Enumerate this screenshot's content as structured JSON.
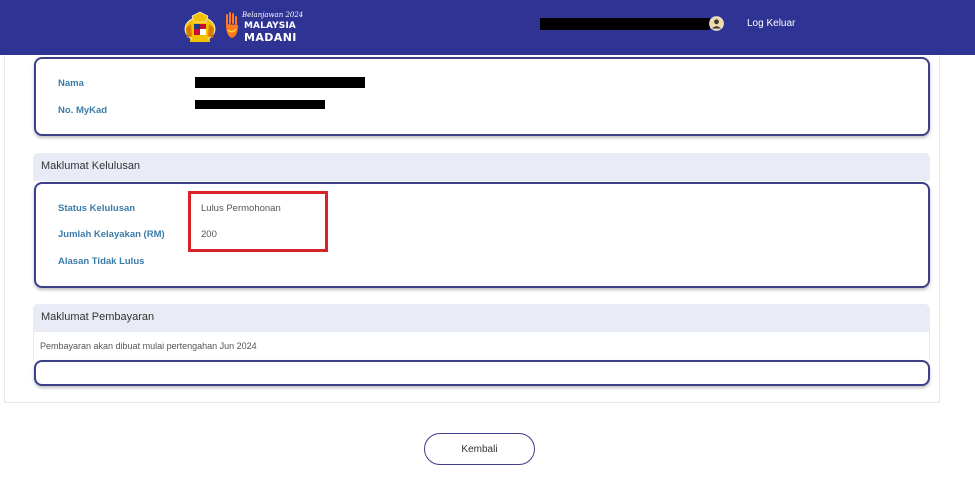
{
  "header": {
    "logo_year": "Belanjawan 2024",
    "logo_line1": "MALAYSIA",
    "logo_line2": "MADANI",
    "logout_label": "Log Keluar",
    "user_icon": "user-circle-icon",
    "background_color": "#2f3494"
  },
  "profile": {
    "name_label": "Nama",
    "mykad_label": "No. MyKad"
  },
  "approval": {
    "section_title": "Maklumat Kelulusan",
    "status_label": "Status Kelulusan",
    "status_value": "Lulus Permohonan",
    "amount_label": "Jumlah Kelayakan (RM)",
    "amount_value": "200",
    "reject_reason_label": "Alasan Tidak Lulus",
    "highlight_color": "#d8232a"
  },
  "payment": {
    "section_title": "Maklumat Pembayaran",
    "note": "Pembayaran akan dibuat mulai pertengahan Jun 2024"
  },
  "actions": {
    "back_label": "Kembali"
  },
  "colors": {
    "label_blue": "#3a7ca8",
    "card_border": "#3d3f8a",
    "section_header_bg": "#e9ecf6"
  }
}
